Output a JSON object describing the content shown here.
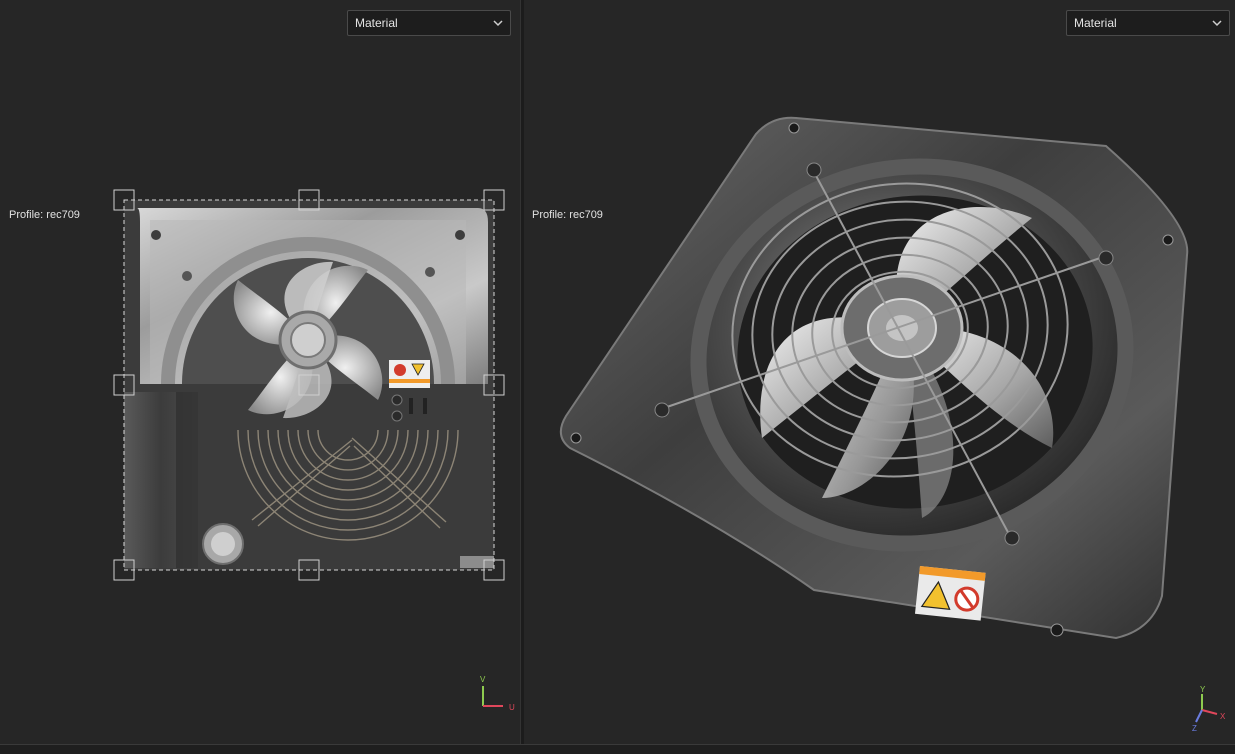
{
  "viewport_2d": {
    "mode_select": "Material",
    "profile_label": "Profile: rec709",
    "axes": {
      "v": "V",
      "u": "U"
    },
    "warning_label": {
      "left_icon": "no-touch-icon",
      "right_icon": "warning-triangle-icon"
    }
  },
  "viewport_3d": {
    "mode_select": "Material",
    "profile_label": "Profile: rec709",
    "axes": {
      "y": "Y",
      "x": "X",
      "z": "Z"
    },
    "warning_label": {
      "left_icon": "warning-triangle-icon",
      "right_icon": "no-touch-icon"
    }
  },
  "colors": {
    "background": "#262626",
    "axis_x": "#e0475b",
    "axis_y": "#8ecb4f",
    "axis_z": "#6a7de0",
    "label_orange": "#f29a2a",
    "selection_dash": "#d8d8d8"
  }
}
